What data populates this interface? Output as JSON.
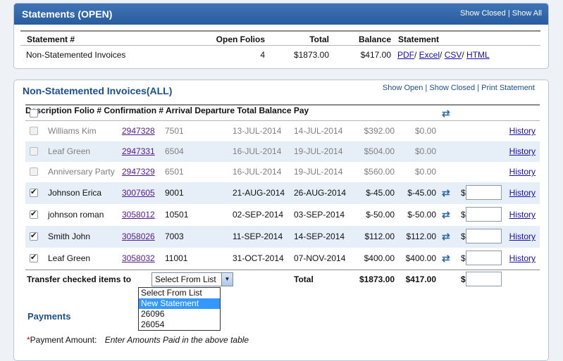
{
  "statements_panel": {
    "title": "Statements (OPEN)",
    "links": [
      "Show Closed",
      "Show All"
    ],
    "columns": {
      "statement": "Statement #",
      "open_folios": "Open Folios",
      "total": "Total",
      "balance": "Balance",
      "statement_formats": "Statement"
    },
    "rows": [
      {
        "statement": "Non-Statemented Invoices",
        "open_folios": "4",
        "total": "$1873.00",
        "balance": "$417.00",
        "formats": [
          "PDF",
          "Excel",
          "CSV",
          "HTML"
        ]
      }
    ]
  },
  "invoices_panel": {
    "title": "Non-Statemented Invoices(ALL)",
    "links": [
      "Show Open",
      "Show Closed",
      "Print Statement"
    ],
    "columns": {
      "description": "Description",
      "folio": "Folio #",
      "confirmation": "Confirmation #",
      "arrival": "Arrival",
      "departure": "Departure",
      "total": "Total",
      "balance": "Balance",
      "pay": "Pay"
    },
    "rows": [
      {
        "description": "Williams Kim",
        "folio": "2947328",
        "confirmation": "7501",
        "arrival": "13-JUL-2014",
        "departure": "14-JUL-2014",
        "total": "$392.00",
        "balance": "$0.00",
        "history": "History",
        "checked": false,
        "disabled": true
      },
      {
        "description": "Leaf Green",
        "folio": "2947331",
        "confirmation": "6504",
        "arrival": "16-JUL-2014",
        "departure": "19-JUL-2014",
        "total": "$504.00",
        "balance": "$0.00",
        "history": "History",
        "checked": false,
        "disabled": true
      },
      {
        "description": "Anniversary Party",
        "folio": "2947329",
        "confirmation": "6501",
        "arrival": "16-JUL-2014",
        "departure": "19-JUL-2014",
        "total": "$560.00",
        "balance": "$0.00",
        "history": "History",
        "checked": false,
        "disabled": true
      },
      {
        "description": "Johnson Erica",
        "folio": "3007605",
        "confirmation": "9001",
        "arrival": "21-AUG-2014",
        "departure": "26-AUG-2014",
        "total": "$-45.00",
        "balance": "$-45.00",
        "pay_prefix": "$",
        "history": "History",
        "checked": true,
        "disabled": false
      },
      {
        "description": "johnson roman",
        "folio": "3058012",
        "confirmation": "10501",
        "arrival": "02-SEP-2014",
        "departure": "03-SEP-2014",
        "total": "$-50.00",
        "balance": "$-50.00",
        "pay_prefix": "$",
        "history": "History",
        "checked": true,
        "disabled": false
      },
      {
        "description": "Smith John",
        "folio": "3058026",
        "confirmation": "7003",
        "arrival": "11-SEP-2014",
        "departure": "14-SEP-2014",
        "total": "$112.00",
        "balance": "$112.00",
        "pay_prefix": "$",
        "history": "History",
        "checked": true,
        "disabled": false
      },
      {
        "description": "Leaf Green",
        "folio": "3058032",
        "confirmation": "11001",
        "arrival": "31-OCT-2014",
        "departure": "07-NOV-2014",
        "total": "$400.00",
        "balance": "$400.00",
        "pay_prefix": "$",
        "history": "History",
        "checked": true,
        "disabled": false
      }
    ],
    "footer": {
      "transfer_label": "Transfer checked items to",
      "select_value": "Select From List",
      "total_label": "Total",
      "total": "$1873.00",
      "balance": "$417.00",
      "pay_prefix": "$"
    },
    "dropdown_options": [
      "Select From List",
      "New Statement",
      "26096",
      "26054"
    ],
    "dropdown_highlighted": "New Statement"
  },
  "payments": {
    "title": "Payments",
    "amount_label": "Payment Amount:",
    "required_marker": "*",
    "amount_hint": "Enter Amounts Paid in the above table"
  },
  "colors": {
    "header_blue": "#285c9e",
    "title_blue": "#1c4f8e",
    "row_alt": "#e6eef8",
    "link": "#1a0dab",
    "visited": "#551a8b"
  }
}
